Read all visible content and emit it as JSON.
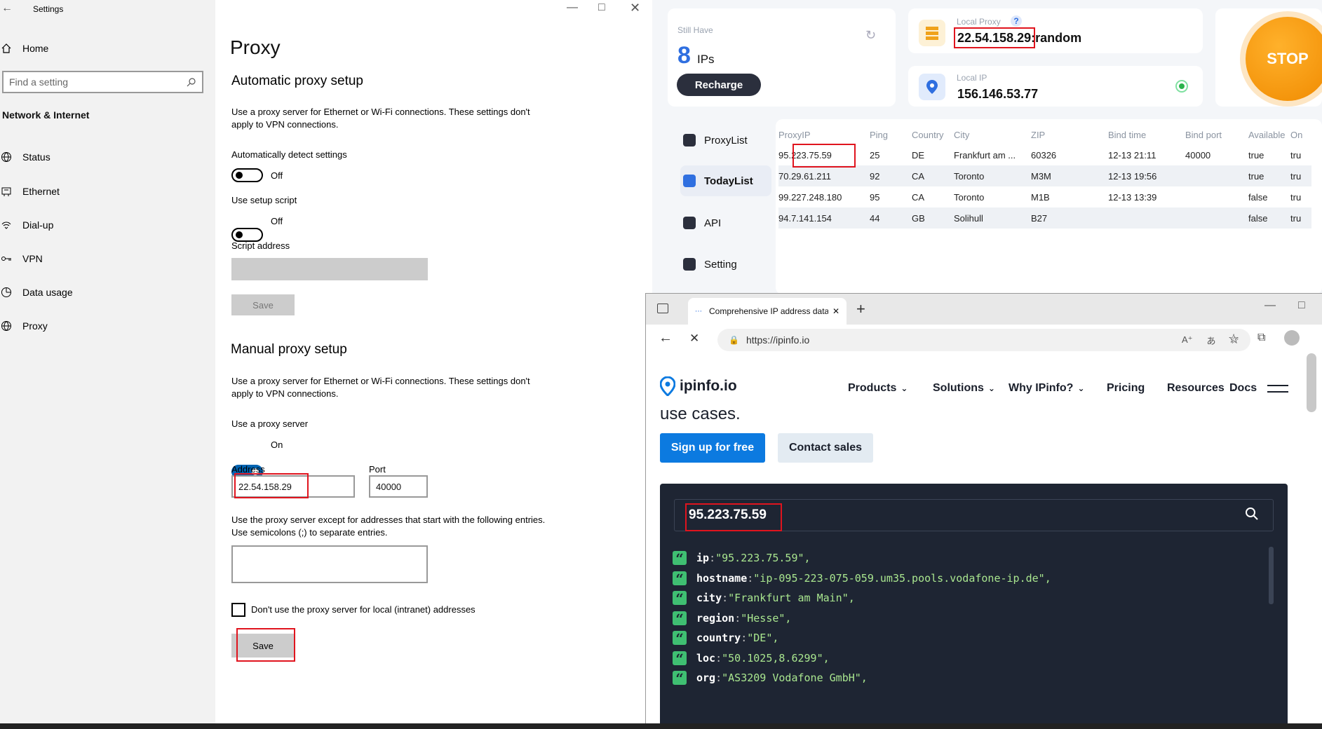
{
  "settings": {
    "window_title": "Settings",
    "home": "Home",
    "search_placeholder": "Find a setting",
    "category": "Network & Internet",
    "nav": [
      "Status",
      "Ethernet",
      "Dial-up",
      "VPN",
      "Data usage",
      "Proxy"
    ],
    "page_title": "Proxy",
    "auto_heading": "Automatic proxy setup",
    "auto_desc": "Use a proxy server for Ethernet or Wi-Fi connections. These settings don't apply to VPN connections.",
    "auto_detect_label": "Automatically detect settings",
    "auto_detect_state": "Off",
    "setup_script_label": "Use setup script",
    "setup_script_state": "Off",
    "script_address_label": "Script address",
    "save_disabled": "Save",
    "manual_heading": "Manual proxy setup",
    "manual_desc": "Use a proxy server for Ethernet or Wi-Fi connections. These settings don't apply to VPN connections.",
    "use_proxy_label": "Use a proxy server",
    "use_proxy_state": "On",
    "address_label": "Address",
    "address_value": "22.54.158.29",
    "port_label": "Port",
    "port_value": "40000",
    "except_desc": "Use the proxy server except for addresses that start with the following entries. Use semicolons (;) to separate entries.",
    "local_checkbox_label": "Don't use the proxy server for local (intranet) addresses",
    "save": "Save"
  },
  "proxyapp": {
    "still_have_label": "Still Have",
    "ips_count": "8",
    "ips_unit": "IPs",
    "recharge": "Recharge",
    "local_proxy_label": "Local Proxy",
    "local_proxy_help": "?",
    "local_proxy_ip": "22.54.158.29",
    "local_proxy_suffix": ":random",
    "local_ip_label": "Local IP",
    "local_ip": "156.146.53.77",
    "stop": "STOP",
    "side": [
      "ProxyList",
      "TodayList",
      "API",
      "Setting"
    ],
    "columns": [
      "ProxyIP",
      "Ping",
      "Country",
      "City",
      "ZIP",
      "Bind time",
      "Bind port",
      "Available",
      "On"
    ],
    "rows": [
      [
        "95.223.75.59",
        "25",
        "DE",
        "Frankfurt am ...",
        "60326",
        "12-13 21:11",
        "40000",
        "true",
        "tru"
      ],
      [
        "70.29.61.211",
        "92",
        "CA",
        "Toronto",
        "M3M",
        "12-13 19:56",
        "",
        "true",
        "tru"
      ],
      [
        "99.227.248.180",
        "95",
        "CA",
        "Toronto",
        "M1B",
        "12-13 13:39",
        "",
        "false",
        "tru"
      ],
      [
        "94.7.141.154",
        "44",
        "GB",
        "Solihull",
        "B27",
        "",
        "",
        "false",
        "tru"
      ]
    ]
  },
  "browser": {
    "tab_title": "Comprehensive IP address data...",
    "url": "https://ipinfo.io",
    "brand": "ipinfo.io",
    "nav": [
      "Products",
      "Solutions",
      "Why IPinfo?",
      "Pricing",
      "Resources",
      "Docs"
    ],
    "hero_fragment": "use cases.",
    "signup": "Sign up for free",
    "contact": "Contact sales",
    "search_ip": "95.223.75.59",
    "json": [
      {
        "k": "ip",
        "v": "\"95.223.75.59\","
      },
      {
        "k": "hostname",
        "v": "\"ip-095-223-075-059.um35.pools.vodafone-ip.de\","
      },
      {
        "k": "city",
        "v": "\"Frankfurt am Main\","
      },
      {
        "k": "region",
        "v": "\"Hesse\","
      },
      {
        "k": "country",
        "v": "\"DE\","
      },
      {
        "k": "loc",
        "v": "\"50.1025,8.6299\","
      },
      {
        "k": "org",
        "v": "\"AS3209 Vodafone GmbH\","
      }
    ]
  }
}
